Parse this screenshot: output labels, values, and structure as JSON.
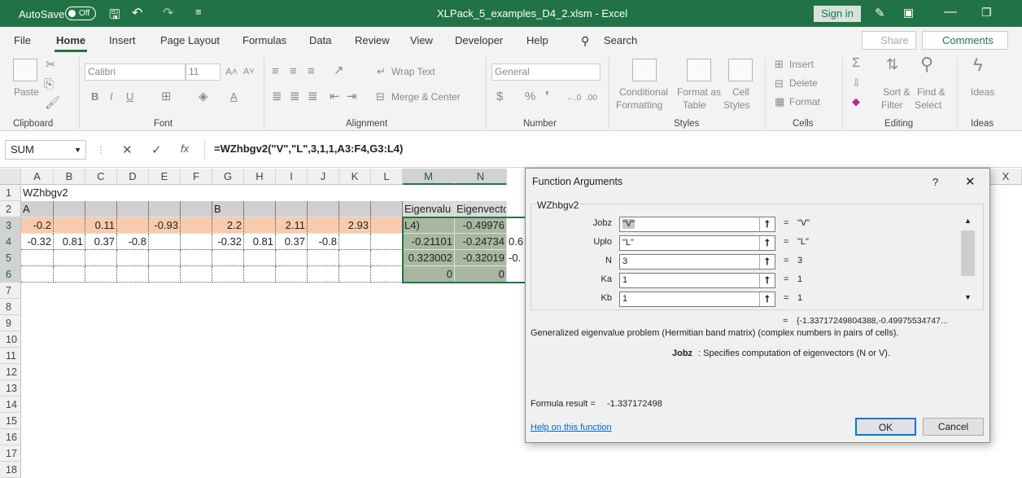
{
  "titlebar": {
    "autosave": "AutoSave",
    "toggle": "Off",
    "doc_title": "XLPack_5_examples_D4_2.xlsm  -  Excel",
    "sign_in": "Sign in"
  },
  "tabs": [
    "File",
    "Home",
    "Insert",
    "Page Layout",
    "Formulas",
    "Data",
    "Review",
    "View",
    "Developer",
    "Help"
  ],
  "search": "Search",
  "share": "Share",
  "comments": "Comments",
  "ribbon": {
    "paste": "Paste",
    "clipboard": "Clipboard",
    "font_name": "Calibri",
    "font_size": "11",
    "font": "Font",
    "wrap_text": "Wrap Text",
    "merge_center": "Merge & Center",
    "alignment": "Alignment",
    "number_format": "General",
    "number": "Number",
    "conditional": "Conditional",
    "formatting": "Formatting",
    "format_as": "Format as",
    "table": "Table",
    "cell": "Cell",
    "styles_btn": "Styles",
    "styles": "Styles",
    "insert": "Insert",
    "delete": "Delete",
    "format": "Format",
    "cells": "Cells",
    "sort": "Sort &",
    "filter": "Filter",
    "find": "Find &",
    "select": "Select",
    "editing": "Editing",
    "ideas_btn": "Ideas",
    "ideas": "Ideas"
  },
  "namebox": "SUM",
  "formula": "=WZhbgv2(\"V\",\"L\",3,1,1,A3:F4,G3:L4)",
  "columns": [
    "A",
    "B",
    "C",
    "D",
    "E",
    "F",
    "G",
    "H",
    "I",
    "J",
    "K",
    "L",
    "M",
    "N",
    "X"
  ],
  "rows": [
    "1",
    "2",
    "3",
    "4",
    "5",
    "6",
    "7",
    "8",
    "9",
    "10",
    "11",
    "12",
    "13",
    "14",
    "15",
    "16",
    "17",
    "18"
  ],
  "cells": {
    "A1": "WZhbgv2",
    "A2": "A",
    "G2": "B",
    "M2": "Eigenvalu",
    "N2": "Eigenvectors",
    "A3": "-0.2",
    "C3": "0.11",
    "E3": "-0.93",
    "G3": "2.2",
    "I3": "2.11",
    "K3": "2.93",
    "M3": "L4)",
    "N3": "-0.49976",
    "A4": "-0.32",
    "B4": "0.81",
    "C4": "0.37",
    "D4": "-0.8",
    "G4": "-0.32",
    "H4": "0.81",
    "I4": "0.37",
    "J4": "-0.8",
    "M4": "-0.21101",
    "N4": "-0.24734",
    "O4": "0.6",
    "M5": "0.323002",
    "N5": "-0.32019",
    "O5": "-0.",
    "M6": "0",
    "N6": "0"
  },
  "dialog": {
    "title": "Function Arguments",
    "help_q": "?",
    "close": "✕",
    "function_name": "WZhbgv2",
    "args": [
      {
        "label": "Jobz",
        "value": "\"V\"",
        "result": "\"V\""
      },
      {
        "label": "Uplo",
        "value": "\"L\"",
        "result": "\"L\""
      },
      {
        "label": "N",
        "value": "3",
        "result": "3"
      },
      {
        "label": "Ka",
        "value": "1",
        "result": "1"
      },
      {
        "label": "Kb",
        "value": "1",
        "result": "1"
      }
    ],
    "eq": "=",
    "array_result": "{-1.33717249804388,-0.49975534747...",
    "description": "Generalized eigenvalue problem (Hermitian band matrix) (complex numbers in pairs of cells).",
    "arg_name": "Jobz",
    "arg_desc": ":  Specifies computation of eigenvectors (N or V).",
    "formula_result_label": "Formula result =",
    "formula_result": "-1.337172498",
    "help_link": "Help on this function",
    "ok": "OK",
    "cancel": "Cancel"
  },
  "colors": {
    "excel_green": "#217346",
    "highlight_orange": "#f8cbad",
    "selection_gray": "#a9b7a0",
    "header_gray": "#d0d0d0"
  }
}
